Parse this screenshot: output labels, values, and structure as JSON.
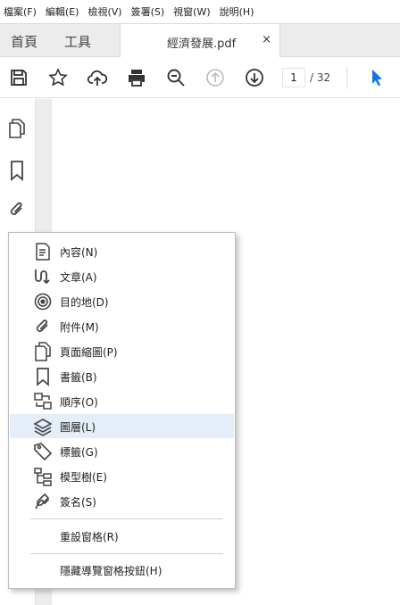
{
  "menubar": {
    "items": [
      {
        "label": "檔案(F)"
      },
      {
        "label": "編輯(E)"
      },
      {
        "label": "檢視(V)"
      },
      {
        "label": "簽署(S)"
      },
      {
        "label": "視窗(W)"
      },
      {
        "label": "說明(H)"
      }
    ]
  },
  "tabs": {
    "home": "首頁",
    "tools": "工具",
    "document": "經濟發展.pdf",
    "close": "×"
  },
  "toolbar": {
    "icons": [
      "save-icon",
      "star-icon",
      "cloud-upload-icon",
      "print-icon",
      "zoom-out-icon",
      "previous-page-icon",
      "next-page-icon",
      "select-cursor-icon"
    ],
    "page_current": "1",
    "page_total": "/ 32",
    "accent": "#1473e6"
  },
  "navpane": {
    "icons": [
      "page-thumbnails-icon",
      "bookmark-icon",
      "attachment-icon"
    ]
  },
  "context_menu": {
    "items": [
      {
        "label": "內容(N)",
        "icon": "content-icon"
      },
      {
        "label": "文章(A)",
        "icon": "article-icon"
      },
      {
        "label": "目的地(D)",
        "icon": "destination-icon"
      },
      {
        "label": "附件(M)",
        "icon": "attachment-icon"
      },
      {
        "label": "頁面縮圖(P)",
        "icon": "page-thumbnails-icon"
      },
      {
        "label": "書籤(B)",
        "icon": "bookmark-icon"
      },
      {
        "label": "順序(O)",
        "icon": "order-icon"
      },
      {
        "label": "圖層(L)",
        "icon": "layers-icon",
        "highlighted": true
      },
      {
        "label": "標籤(G)",
        "icon": "tags-icon"
      },
      {
        "label": "模型樹(E)",
        "icon": "model-tree-icon"
      },
      {
        "label": "簽名(S)",
        "icon": "signature-icon"
      }
    ],
    "reset": "重設窗格(R)",
    "hide": "隱藏導覽窗格按鈕(H)",
    "highlight_color": "#e4eef8"
  }
}
